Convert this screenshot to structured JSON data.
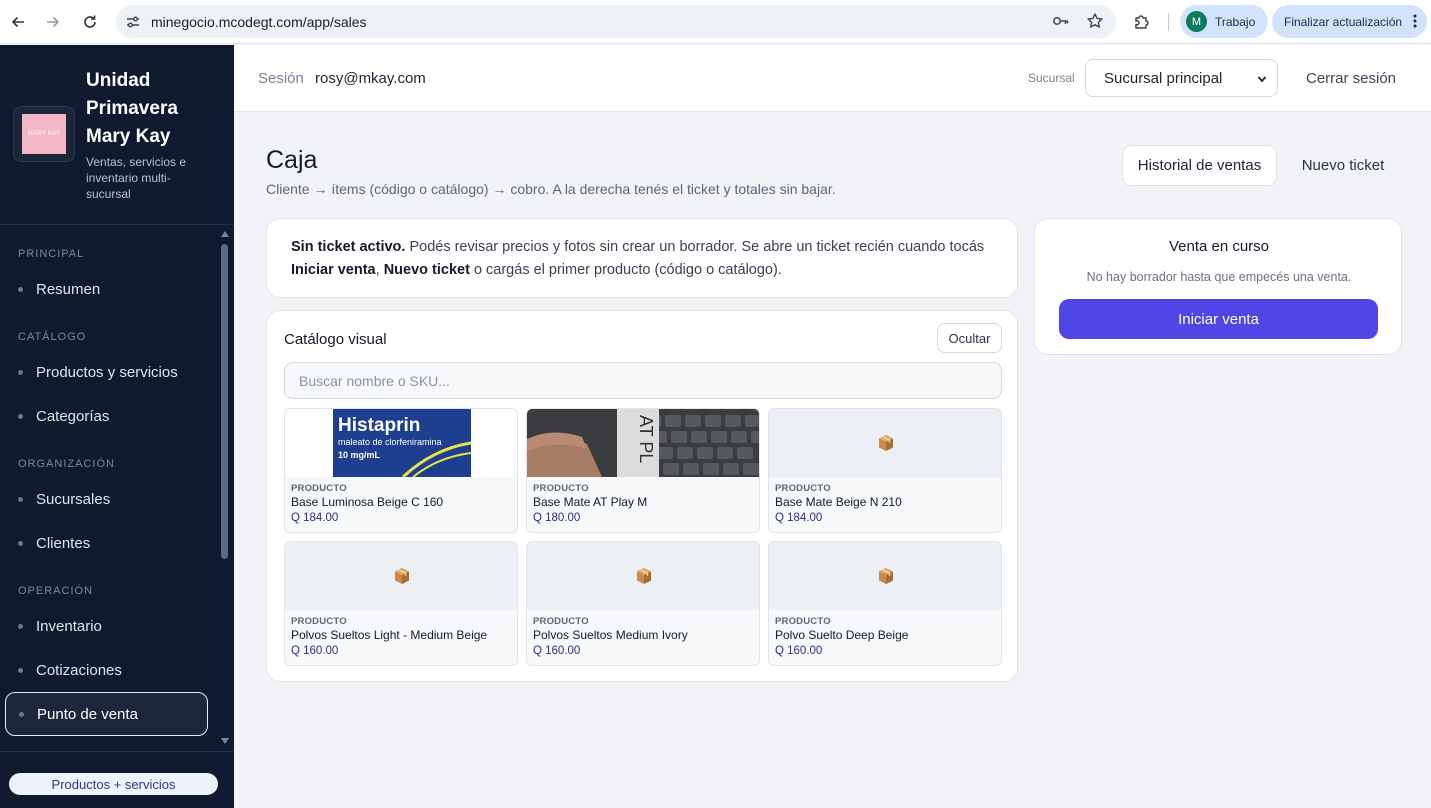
{
  "browser": {
    "url": "minegocio.mcodegt.com/app/sales",
    "profile_initial": "M",
    "profile_name": "Trabajo",
    "update_label": "Finalizar actualización"
  },
  "sidebar": {
    "brand_title": "Unidad Primavera Mary Kay",
    "brand_subtitle": "Ventas, servicios e inventario multi-sucursal",
    "logo_text": "MARY KAY",
    "sections": [
      {
        "title": "PRINCIPAL",
        "items": [
          "Resumen"
        ]
      },
      {
        "title": "CATÁLOGO",
        "items": [
          "Productos y servicios",
          "Categorías"
        ]
      },
      {
        "title": "ORGANIZACIÓN",
        "items": [
          "Sucursales",
          "Clientes"
        ]
      },
      {
        "title": "OPERACIÓN",
        "items": [
          "Inventario",
          "Cotizaciones",
          "Punto de venta"
        ]
      }
    ],
    "active_item": "Punto de venta",
    "footer_button": "Productos + servicios"
  },
  "topbar": {
    "session_label": "Sesión",
    "session_user": "rosy@mkay.com",
    "branch_label": "Sucursal",
    "branch_value": "Sucursal principal",
    "logout_label": "Cerrar sesión"
  },
  "main": {
    "title": "Caja",
    "subtitle": "Cliente → ítems (código o catálogo) → cobro. A la derecha tenés el ticket y totales sin bajar.",
    "history_button": "Historial de ventas",
    "new_ticket_button": "Nuevo ticket",
    "notice": {
      "lead": "Sin ticket activo.",
      "text1": " Podés revisar precios y fotos sin crear un borrador. Se abre un ticket recién cuando tocás ",
      "bold1": "Iniciar venta",
      "text2": ", ",
      "bold2": "Nuevo ticket",
      "text3": " o cargás el primer producto (código o catálogo)."
    },
    "catalog": {
      "title": "Catálogo visual",
      "hide_button": "Ocultar",
      "search_placeholder": "Buscar nombre o SKU...",
      "products": [
        {
          "kind": "PRODUCTO",
          "name": "Base Luminosa Beige C 160",
          "price": "Q 184.00",
          "image": "histaprin-box",
          "image_text": "Histaprin",
          "image_sub1": "maleato de clorfeniramina",
          "image_sub2": "10 mg/mL"
        },
        {
          "kind": "PRODUCTO",
          "name": "Base Mate AT Play M",
          "price": "Q 180.00",
          "image": "photo-product",
          "image_text": "AT PL"
        },
        {
          "kind": "PRODUCTO",
          "name": "Base Mate Beige N 210",
          "price": "Q 184.00",
          "image": "box-icon"
        },
        {
          "kind": "PRODUCTO",
          "name": "Polvos Sueltos Light - Medium Beige",
          "price": "Q 160.00",
          "image": "box-icon"
        },
        {
          "kind": "PRODUCTO",
          "name": "Polvos Sueltos Medium Ivory",
          "price": "Q 160.00",
          "image": "box-icon"
        },
        {
          "kind": "PRODUCTO",
          "name": "Polvo Suelto Deep Beige",
          "price": "Q 160.00",
          "image": "box-icon"
        }
      ]
    },
    "sale": {
      "title": "Venta en curso",
      "note": "No hay borrador hasta que empecés una venta.",
      "start_button": "Iniciar venta"
    }
  },
  "colors": {
    "sidebar_bg": "#0f1a2e",
    "accent": "#4f46e5",
    "price": "#2a2f8a"
  }
}
